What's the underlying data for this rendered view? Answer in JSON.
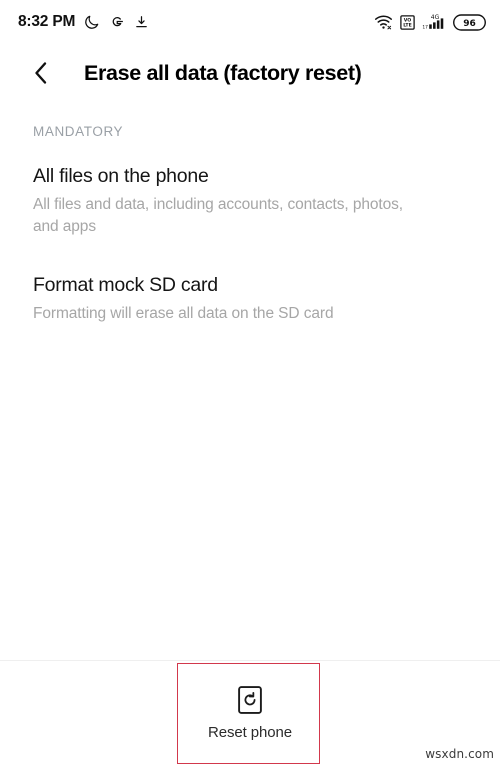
{
  "status_bar": {
    "time": "8:32 PM",
    "left_icons": [
      {
        "name": "do-not-disturb-moon-icon",
        "glyph": "moon"
      },
      {
        "name": "google-g-icon",
        "glyph": "G"
      },
      {
        "name": "download-icon",
        "glyph": "download"
      }
    ],
    "right_icons": [
      {
        "name": "wifi-icon",
        "label": "Wi-Fi"
      },
      {
        "name": "volte-icon",
        "label": "VoLTE"
      },
      {
        "name": "cellular-signal-icon",
        "label": "4G"
      }
    ],
    "network_type": "4G",
    "battery_percent": "96"
  },
  "header": {
    "back_label": "Back",
    "title": "Erase all data (factory reset)"
  },
  "content": {
    "section_label": "MANDATORY",
    "items": [
      {
        "title": "All files on the phone",
        "desc": "All files and data, including accounts, contacts, photos, and apps"
      },
      {
        "title": "Format mock SD card",
        "desc": "Formatting will erase all data on the SD card"
      }
    ]
  },
  "bottom_bar": {
    "reset_label": "Reset phone",
    "reset_icon": "phone-reset-icon"
  },
  "annotation": {
    "color": "#d2384c"
  },
  "watermark": "wsxdn.com"
}
